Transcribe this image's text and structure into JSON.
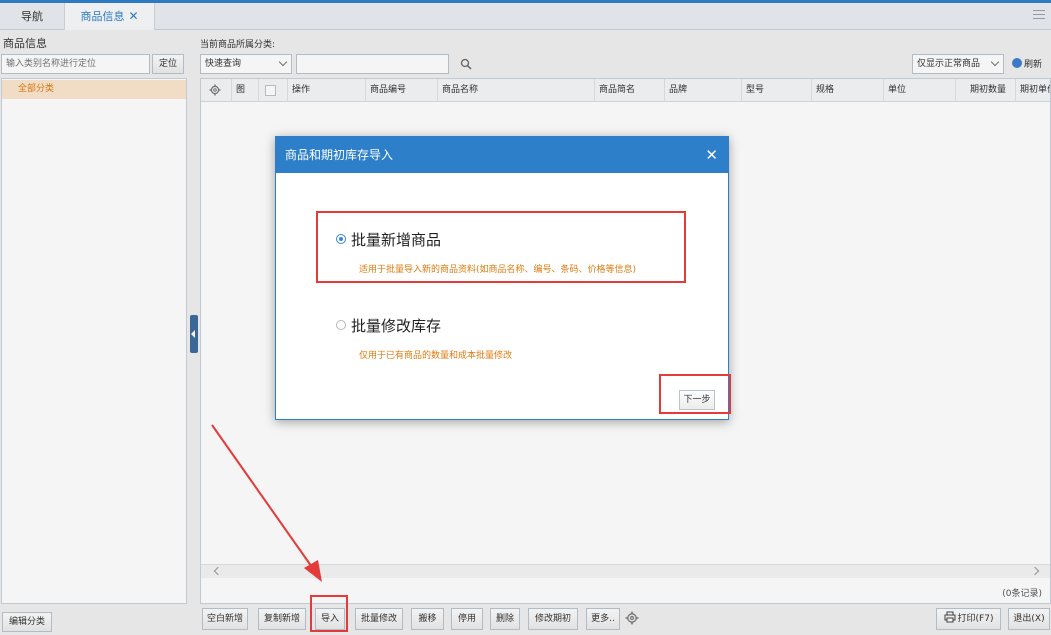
{
  "tabs": {
    "nav": "导航",
    "goods": "商品信息",
    "close": "✕"
  },
  "left_panel": {
    "title": "商品信息",
    "search_placeholder": "输入类别名称进行定位",
    "locate_button": "定位",
    "tree_items": [
      "全部分类"
    ],
    "edit_category_button": "编辑分类"
  },
  "filter": {
    "category_label": "当前商品所属分类:",
    "quick_query": "快速查询",
    "show_normal": "仅显示正常商品",
    "refresh": "刷新"
  },
  "grid": {
    "columns": [
      "图",
      "操作",
      "商品编号",
      "商品名称",
      "商品简名",
      "品牌",
      "型号",
      "规格",
      "单位",
      "期初数量",
      "期初单价"
    ],
    "records": "(0条记录)"
  },
  "toolbar": {
    "blank_new": "空白新增",
    "copy_new": "复制新增",
    "import": "导入",
    "batch_edit": "批量修改",
    "move": "搬移",
    "disable": "停用",
    "delete": "删除",
    "edit_period": "修改期初",
    "more": "更多..",
    "print": "打印(F7)",
    "exit": "退出(X)"
  },
  "dialog": {
    "title": "商品和期初库存导入",
    "close": "✕",
    "option_1": {
      "label": "批量新增商品",
      "desc": "适用于批量导入新的商品资料(如商品名称、编号、条码、价格等信息)",
      "selected": true
    },
    "option_2": {
      "label": "批量修改库存",
      "desc": "仅用于已有商品的数量和成本批量修改",
      "selected": false
    },
    "next_button": "下一步"
  },
  "colors": {
    "accent": "#2c7fc8",
    "orange_text": "#e07b10",
    "annotation_red": "#e53a3a"
  }
}
